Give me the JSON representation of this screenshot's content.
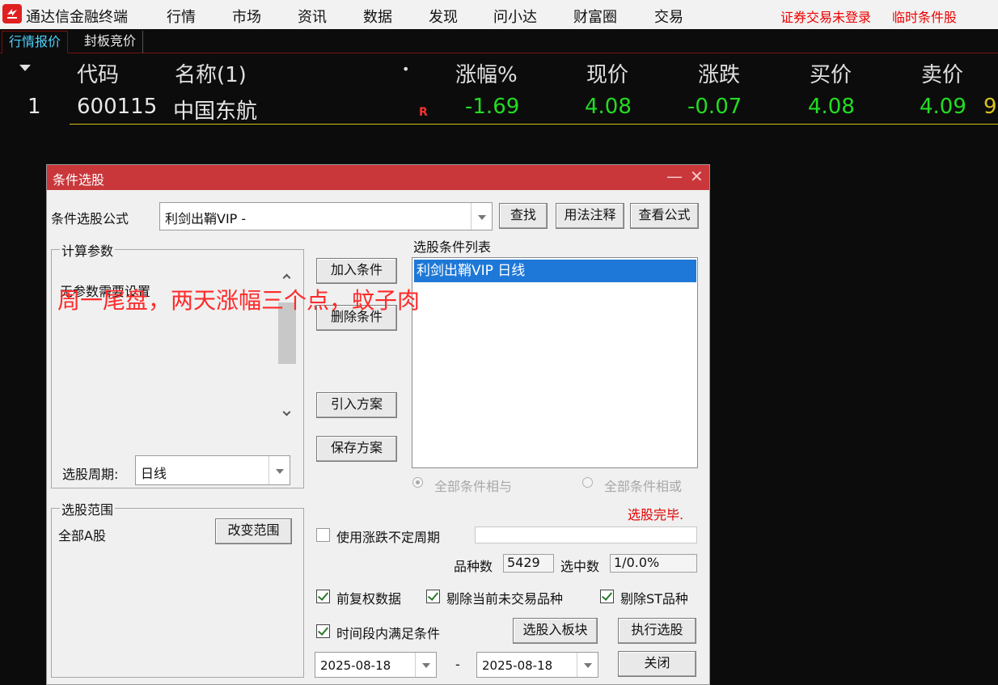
{
  "app": {
    "title": "通达信金融终端",
    "menu": [
      "行情",
      "市场",
      "资讯",
      "数据",
      "发现",
      "问小达",
      "财富圈",
      "交易"
    ],
    "status_login": "证券交易未登录",
    "status_temp": "临时条件股"
  },
  "tabs": [
    "行情报价",
    "封板竞价"
  ],
  "quote": {
    "headers": {
      "code": "代码",
      "name": "名称(1)",
      "dot": "•",
      "change_pct": "涨幅%",
      "price": "现价",
      "change": "涨跌",
      "bid": "买价",
      "ask": "卖价"
    },
    "rows": [
      {
        "index": "1",
        "code": "600115",
        "name": "中国东航",
        "flag": "R",
        "change_pct": "-1.69",
        "price": "4.08",
        "change": "-0.07",
        "bid": "4.08",
        "ask": "4.09",
        "extra": "9"
      }
    ]
  },
  "dialog": {
    "title": "条件选股",
    "minimize": "—",
    "close": "✕",
    "formula_label": "条件选股公式",
    "formula_value": "利剑出鞘VIP  -",
    "btn_find": "查找",
    "btn_usage": "用法注释",
    "btn_view": "查看公式",
    "params_group": "计算参数",
    "params_text": "无参数需要设置",
    "btn_add": "加入条件",
    "btn_delete": "删除条件",
    "btn_import": "引入方案",
    "btn_save": "保存方案",
    "conditions_label": "选股条件列表",
    "conditions": [
      "利剑出鞘VIP  日线"
    ],
    "radio_and": "全部条件相与",
    "radio_or": "全部条件相或",
    "period_label": "选股周期:",
    "period_value": "日线",
    "status_done": "选股完毕.",
    "range_group": "选股范围",
    "range_value": "全部A股",
    "btn_change_range": "改变范围",
    "use_variable_period": "使用涨跌不定周期",
    "count_label": "品种数",
    "count_value": "5429",
    "selected_label": "选中数",
    "selected_value": "1/0.0%",
    "chk_forward_adjust": "前复权数据",
    "chk_exclude_untraded": "剔除当前未交易品种",
    "chk_exclude_st": "剔除ST品种",
    "chk_time_range": "时间段内满足条件",
    "btn_to_block": "选股入板块",
    "btn_execute": "执行选股",
    "date_from": "2025-08-18",
    "date_sep": "-",
    "date_to": "2025-08-18",
    "btn_close": "关闭"
  },
  "annotation": "周一尾盘，两天涨幅三个点，蚊子肉",
  "colors": {
    "title_bar": "#c9373b",
    "positive_green": "#22dd22",
    "accent_red": "#ee0000",
    "tab_active": "#4fd3ff",
    "selection_blue": "#1e78d7"
  }
}
